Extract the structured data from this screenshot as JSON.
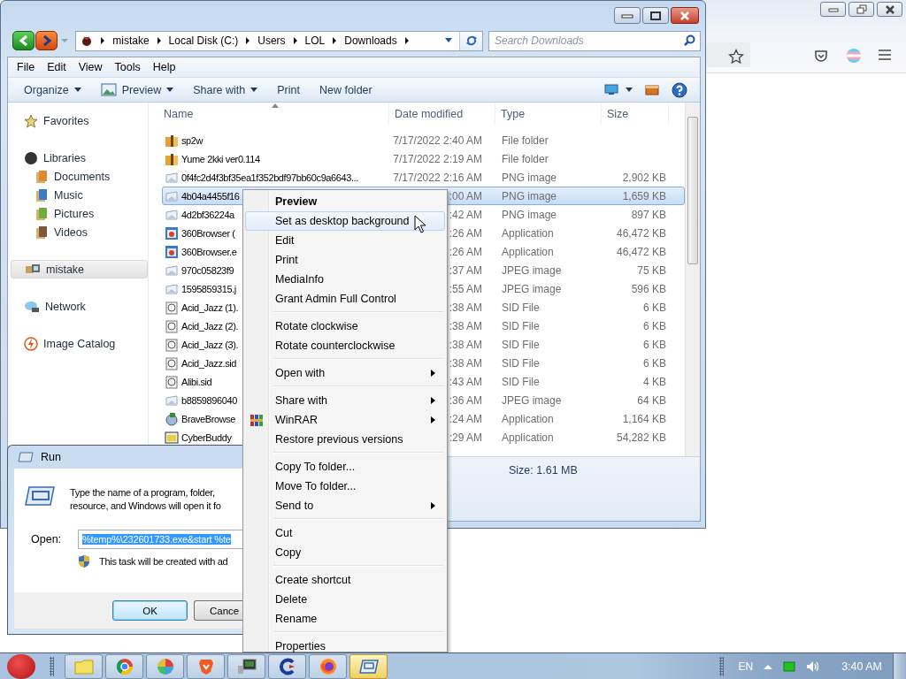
{
  "explorer": {
    "address": {
      "crumbs": [
        "mistake",
        "Local Disk (C:)",
        "Users",
        "LOL",
        "Downloads"
      ]
    },
    "search": {
      "placeholder": "Search Downloads"
    },
    "menu_bar": [
      "File",
      "Edit",
      "View",
      "Tools",
      "Help"
    ],
    "commands": [
      {
        "label": "Organize",
        "dropdown": true,
        "icon": false
      },
      {
        "label": "Preview",
        "dropdown": true,
        "icon": true
      },
      {
        "label": "Share with",
        "dropdown": true,
        "icon": false
      },
      {
        "label": "Print",
        "dropdown": false,
        "icon": false
      },
      {
        "label": "New folder",
        "dropdown": false,
        "icon": false
      }
    ],
    "nav": [
      {
        "label": "Favorites",
        "selected": false
      },
      {
        "label": "Libraries",
        "selected": false,
        "children": [
          {
            "label": "Documents",
            "selected": false
          },
          {
            "label": "Music",
            "selected": false
          },
          {
            "label": "Pictures",
            "selected": false
          },
          {
            "label": "Videos",
            "selected": false
          }
        ]
      },
      {
        "label": "mistake",
        "selected": true
      },
      {
        "label": "Network",
        "selected": false
      },
      {
        "label": "Image Catalog",
        "selected": false
      }
    ],
    "columns": [
      "Name",
      "Date modified",
      "Type",
      "Size"
    ],
    "files": [
      {
        "kind": "folder",
        "name": "sp2w",
        "date": "7/17/2022 2:40 AM",
        "type": "File folder",
        "selected": false
      },
      {
        "kind": "folder",
        "name": "Yume 2kki ver0.114",
        "date": "7/17/2022 2:19 AM",
        "type": "File folder",
        "selected": false
      },
      {
        "kind": "image",
        "name": "0f4fc2d4f3bf35ea1f352bdf97bb60c9a6643...",
        "date": "7/17/2022 2:16 AM",
        "type": "PNG image",
        "size": "2,902 KB",
        "selected": false
      },
      {
        "kind": "image",
        "name": "4b04a4455f16",
        "date": ":00 AM",
        "type": "PNG image",
        "size": "1,659 KB",
        "selected": true
      },
      {
        "kind": "image",
        "name": "4d2bf36224a",
        "date": ":42 AM",
        "type": "PNG image",
        "size": "897 KB",
        "selected": false
      },
      {
        "kind": "app",
        "name": "360Browser (",
        "date": ":26 AM",
        "type": "Application",
        "size": "46,472 KB",
        "selected": false
      },
      {
        "kind": "app",
        "name": "360Browser.e",
        "date": ":26 AM",
        "type": "Application",
        "size": "46,472 KB",
        "selected": false
      },
      {
        "kind": "image",
        "name": "970c05823f9",
        "date": ":37 AM",
        "type": "JPEG image",
        "size": "75 KB",
        "selected": false
      },
      {
        "kind": "image",
        "name": "1595859315.j",
        "date": ":55 AM",
        "type": "JPEG image",
        "size": "596 KB",
        "selected": false
      },
      {
        "kind": "sid",
        "name": "Acid_Jazz (1).",
        "date": ":38 AM",
        "type": "SID File",
        "size": "6 KB",
        "selected": false
      },
      {
        "kind": "sid",
        "name": "Acid_Jazz (2).",
        "date": ":38 AM",
        "type": "SID File",
        "size": "6 KB",
        "selected": false
      },
      {
        "kind": "sid",
        "name": "Acid_Jazz (3).",
        "date": ":38 AM",
        "type": "SID File",
        "size": "6 KB",
        "selected": false
      },
      {
        "kind": "sid",
        "name": "Acid_Jazz.sid",
        "date": ":38 AM",
        "type": "SID File",
        "size": "6 KB",
        "selected": false
      },
      {
        "kind": "sid",
        "name": "Alibi.sid",
        "date": ":43 AM",
        "type": "SID File",
        "size": "4 KB",
        "selected": false
      },
      {
        "kind": "image",
        "name": "b8859896040",
        "date": ":36 AM",
        "type": "JPEG image",
        "size": "64 KB",
        "selected": false
      },
      {
        "kind": "installer",
        "name": "BraveBrowse",
        "date": ":24 AM",
        "type": "Application",
        "size": "1,164 KB",
        "selected": false
      },
      {
        "kind": "program",
        "name": "CyberBuddy",
        "date": ":29 AM",
        "type": "Application",
        "size": "54,282 KB",
        "selected": false
      }
    ],
    "details": "Size: 1.61 MB"
  },
  "context_menu": {
    "groups": [
      [
        {
          "label": "Preview",
          "default": true,
          "selected": false,
          "submenu": false,
          "icon": false
        },
        {
          "label": "Set as desktop background",
          "default": false,
          "selected": true,
          "submenu": false,
          "icon": false
        },
        {
          "label": "Edit",
          "default": false,
          "selected": false,
          "submenu": false,
          "icon": false
        },
        {
          "label": "Print",
          "default": false,
          "selected": false,
          "submenu": false,
          "icon": false
        },
        {
          "label": "MediaInfo",
          "default": false,
          "selected": false,
          "submenu": false,
          "icon": false
        },
        {
          "label": "Grant Admin Full Control",
          "default": false,
          "selected": false,
          "submenu": false,
          "icon": false
        }
      ],
      [
        {
          "label": "Rotate clockwise",
          "default": false,
          "selected": false,
          "submenu": false,
          "icon": false
        },
        {
          "label": "Rotate counterclockwise",
          "default": false,
          "selected": false,
          "submenu": false,
          "icon": false
        }
      ],
      [
        {
          "label": "Open with",
          "default": false,
          "selected": false,
          "submenu": true,
          "icon": false
        }
      ],
      [
        {
          "label": "Share with",
          "default": false,
          "selected": false,
          "submenu": true,
          "icon": false
        },
        {
          "label": "WinRAR",
          "default": false,
          "selected": false,
          "submenu": true,
          "icon": true
        },
        {
          "label": "Restore previous versions",
          "default": false,
          "selected": false,
          "submenu": false,
          "icon": false
        }
      ],
      [
        {
          "label": "Copy To folder...",
          "default": false,
          "selected": false,
          "submenu": false,
          "icon": false
        },
        {
          "label": "Move To folder...",
          "default": false,
          "selected": false,
          "submenu": false,
          "icon": false
        },
        {
          "label": "Send to",
          "default": false,
          "selected": false,
          "submenu": true,
          "icon": false
        }
      ],
      [
        {
          "label": "Cut",
          "default": false,
          "selected": false,
          "submenu": false,
          "icon": false
        },
        {
          "label": "Copy",
          "default": false,
          "selected": false,
          "submenu": false,
          "icon": false
        }
      ],
      [
        {
          "label": "Create shortcut",
          "default": false,
          "selected": false,
          "submenu": false,
          "icon": false
        },
        {
          "label": "Delete",
          "default": false,
          "selected": false,
          "submenu": false,
          "icon": false
        },
        {
          "label": "Rename",
          "default": false,
          "selected": false,
          "submenu": false,
          "icon": false
        }
      ],
      [
        {
          "label": "Properties",
          "default": false,
          "selected": false,
          "submenu": false,
          "icon": false
        }
      ]
    ]
  },
  "run_dialog": {
    "title": "Run",
    "message_lines": [
      "Type the name of a program, folder,",
      "resource, and Windows will open it fo"
    ],
    "open_label": "Open:",
    "value": "%temp%\\232601733.exe&start %te",
    "value_selected": true,
    "note": "This task will be created with ad",
    "buttons": [
      {
        "label": "OK",
        "default": true
      },
      {
        "label": "Cance",
        "default": false
      }
    ]
  },
  "taskbar": {
    "apps": [
      {
        "selected": false
      },
      {
        "selected": false
      },
      {
        "selected": false
      },
      {
        "selected": false
      },
      {
        "selected": false
      },
      {
        "selected": false
      },
      {
        "selected": false
      },
      {
        "selected": true
      }
    ],
    "language": "EN",
    "clock": "3:40 AM"
  }
}
